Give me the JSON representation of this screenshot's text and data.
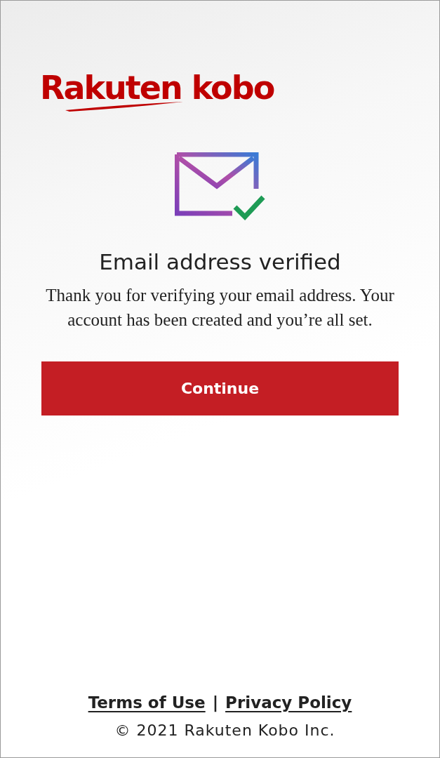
{
  "logo": {
    "text": "Rakuten kobo"
  },
  "title": "Email address verified",
  "message": "Thank you for verifying your email address. Your account has been created and you’re all set.",
  "continue_button": {
    "label": "Continue"
  },
  "footer": {
    "links": [
      {
        "label": "Terms of Use"
      },
      {
        "label": "Privacy Policy"
      }
    ],
    "separator": "|",
    "copyright": "© 2021 Rakuten Kobo Inc."
  }
}
